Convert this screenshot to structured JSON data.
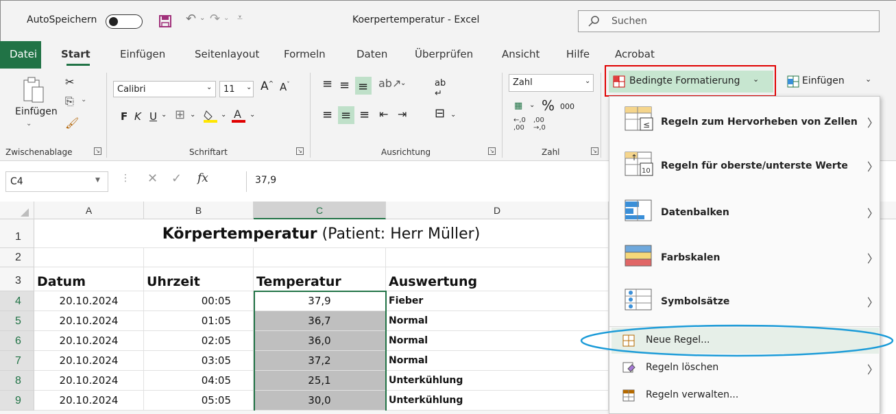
{
  "titlebar": {
    "autosave_label": "AutoSpeichern",
    "toggle_state": "Aus",
    "window_title": "Koerpertemperatur - Excel",
    "search_placeholder": "Suchen"
  },
  "menu_tabs": [
    {
      "label": "Datei"
    },
    {
      "label": "Start"
    },
    {
      "label": "Einfügen"
    },
    {
      "label": "Seitenlayout"
    },
    {
      "label": "Formeln"
    },
    {
      "label": "Daten"
    },
    {
      "label": "Überprüfen"
    },
    {
      "label": "Ansicht"
    },
    {
      "label": "Hilfe"
    },
    {
      "label": "Acrobat"
    }
  ],
  "ribbon": {
    "clipboard": {
      "paste_label": "Einfügen",
      "group_label": "Zwischenablage"
    },
    "font": {
      "font_name": "Calibri",
      "font_size": "11",
      "bold": "F",
      "italic": "K",
      "underline": "U",
      "group_label": "Schriftart"
    },
    "alignment": {
      "group_label": "Ausrichtung"
    },
    "number": {
      "format": "Zahl",
      "percent": "%",
      "thousands": "000",
      "inc_decimal_a": "←,0",
      "inc_decimal_b": ",00",
      "dec_decimal_a": ",00",
      "dec_decimal_b": "→,0",
      "group_label": "Zahl"
    },
    "conditional_formatting_label": "Bedingte Formatierung",
    "insert_label": "Einfügen"
  },
  "formula_bar": {
    "name_box": "C4",
    "fx": "fx",
    "value": "37,9"
  },
  "columns": [
    "A",
    "B",
    "C",
    "D"
  ],
  "rows": [
    {
      "num": "1",
      "a": "",
      "b": "",
      "c": "",
      "d": ""
    },
    {
      "num": "2",
      "a": "",
      "b": "",
      "c": "",
      "d": ""
    },
    {
      "num": "3",
      "a": "Datum",
      "b": "Uhrzeit",
      "c": "Temperatur",
      "d": "Auswertung"
    },
    {
      "num": "4",
      "a": "20.10.2024",
      "b": "00:05",
      "c": "37,9",
      "d": "Fieber"
    },
    {
      "num": "5",
      "a": "20.10.2024",
      "b": "01:05",
      "c": "36,7",
      "d": "Normal"
    },
    {
      "num": "6",
      "a": "20.10.2024",
      "b": "02:05",
      "c": "36,0",
      "d": "Normal"
    },
    {
      "num": "7",
      "a": "20.10.2024",
      "b": "03:05",
      "c": "37,2",
      "d": "Normal"
    },
    {
      "num": "8",
      "a": "20.10.2024",
      "b": "04:05",
      "c": "25,1",
      "d": "Unterkühlung"
    },
    {
      "num": "9",
      "a": "20.10.2024",
      "b": "05:05",
      "c": "30,0",
      "d": "Unterkühlung"
    }
  ],
  "sheet_title": {
    "bold_part": "Körpertemperatur",
    "normal_part": " (Patient: Herr Müller)"
  },
  "dropdown": {
    "items": [
      {
        "label": "Regeln zum Hervorheben von Zellen"
      },
      {
        "label": "Regeln für oberste/unterste Werte"
      },
      {
        "label": "Datenbalken"
      },
      {
        "label": "Farbskalen"
      },
      {
        "label": "Symbolsätze"
      }
    ],
    "small_items": [
      {
        "label": "Neue Regel..."
      },
      {
        "label": "Regeln löschen"
      },
      {
        "label": "Regeln verwalten..."
      }
    ]
  },
  "colors": {
    "excel_green": "#217346",
    "highlight_red": "#e00000",
    "annotation_blue": "#1b9bd8",
    "selected_cell_fill": "#bfbfbf"
  }
}
